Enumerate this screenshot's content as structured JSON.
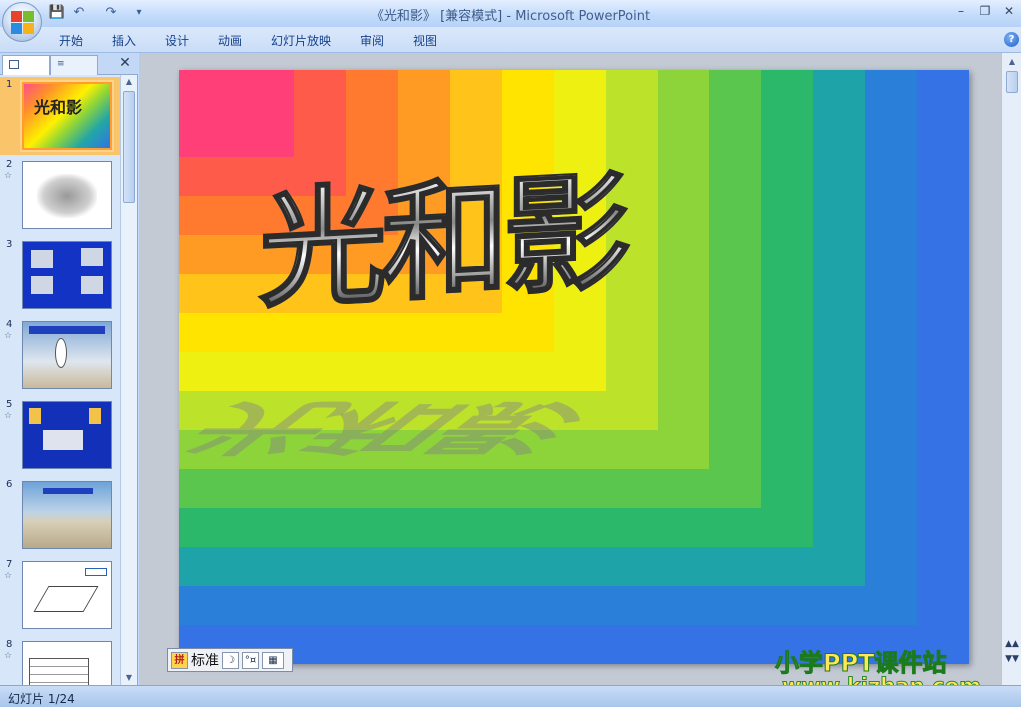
{
  "window": {
    "doc_title": "《光和影》",
    "mode": "[兼容模式]",
    "separator": "-",
    "app_name": "Microsoft PowerPoint",
    "minimize": "–",
    "restore": "❐",
    "close": "✕"
  },
  "quick_access": {
    "save": "💾",
    "undo": "↶",
    "redo": "↷",
    "customize": "▾"
  },
  "ribbon_tabs": [
    "开始",
    "插入",
    "设计",
    "动画",
    "幻灯片放映",
    "审阅",
    "视图"
  ],
  "help": "?",
  "left_pane": {
    "close": "✕",
    "slides": [
      {
        "num": "1",
        "star": ""
      },
      {
        "num": "2",
        "star": "☆"
      },
      {
        "num": "3",
        "star": ""
      },
      {
        "num": "4",
        "star": "☆"
      },
      {
        "num": "5",
        "star": "☆"
      },
      {
        "num": "6",
        "star": ""
      },
      {
        "num": "7",
        "star": "☆"
      },
      {
        "num": "8",
        "star": "☆"
      }
    ],
    "selected_index": 0
  },
  "slide": {
    "title": "光和影",
    "band_colors": [
      "#3472e6",
      "#2a80d8",
      "#1ea3a8",
      "#2cb86a",
      "#5ac64e",
      "#8dd43a",
      "#bde22a",
      "#eef012",
      "#ffe400",
      "#ffc31a",
      "#ff9a22",
      "#ff7a2e",
      "#ff5b4a",
      "#ff3f78"
    ]
  },
  "drawing_toolbar": {
    "label": "标准",
    "moon": "☽",
    "dots": "°¤",
    "keyboard": "▦",
    "ime": "拼"
  },
  "watermark": {
    "line1": "小学PPT课件站",
    "line2": "www.kjzhan.com"
  },
  "nav": {
    "prev": "▲▲",
    "next": "▼▼"
  },
  "status": {
    "slide_info": "幻灯片 1/24"
  }
}
